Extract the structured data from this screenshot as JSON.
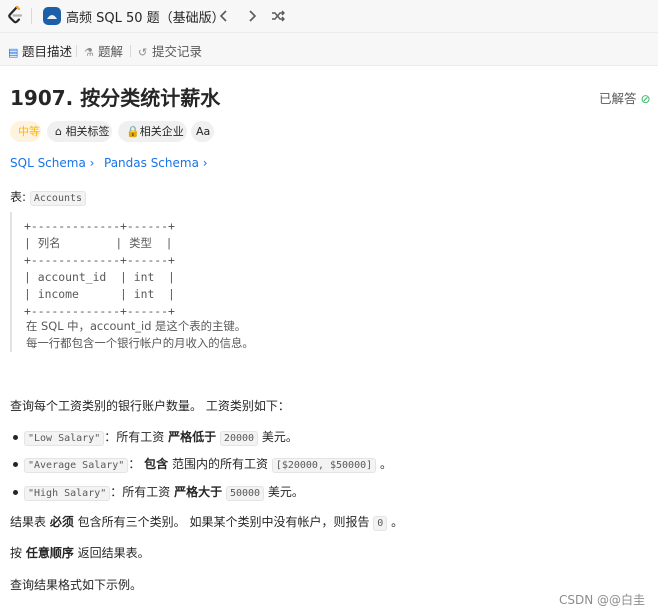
{
  "topbar": {
    "list_title": "高频 SQL 50 题（基础版）"
  },
  "tabs": [
    {
      "label": "题目描述"
    },
    {
      "label": "题解"
    },
    {
      "label": "提交记录"
    }
  ],
  "problem": {
    "title": "1907. 按分类统计薪水",
    "status": "已解答",
    "tags": [
      "中等",
      "相关标签",
      "相关企业",
      "Aa"
    ],
    "schema_links": [
      "SQL Schema",
      "Pandas Schema"
    ]
  },
  "desc": {
    "table_label": "表:",
    "table_name": "Accounts",
    "table_schema": "+-------------+------+\n| 列名        | 类型  |\n+-------------+------+\n| account_id  | int  |\n| income      | int  |\n+-------------+------+",
    "note1": "在 SQL 中，account_id 是这个表的主键。",
    "note2": "每一行都包含一个银行帐户的月收入的信息。",
    "intro": "查询每个工资类别的银行账户数量。 工资类别如下：",
    "bullets": [
      {
        "code": "\"Low Salary\"",
        "mid": "：所有工资 ",
        "bold": "严格低于",
        "code2": "20000",
        "tail": " 美元。"
      },
      {
        "code": "\"Average Salary\"",
        "mid": "： ",
        "bold": "包含",
        "mid2": " 范围内的所有工资 ",
        "code2": "[$20000, $50000]",
        "tail": " 。"
      },
      {
        "code": "\"High Salary\"",
        "mid": "：所有工资 ",
        "bold": "严格大于",
        "code2": "50000",
        "tail": " 美元。"
      }
    ],
    "result_pre": "结果表 ",
    "result_bold": "必须",
    "result_mid": " 包含所有三个类别。 如果某个类别中没有帐户，则报告 ",
    "result_code": "0",
    "result_tail": " 。",
    "order_pre": "按 ",
    "order_bold": "任意顺序",
    "order_tail": " 返回结果表。",
    "format_line": "查询结果格式如下示例。"
  },
  "watermark": "CSDN @@白圭",
  "colors": {
    "accent": "#1a73e8",
    "difficulty": "#ffb800",
    "solved": "#2db55d"
  }
}
